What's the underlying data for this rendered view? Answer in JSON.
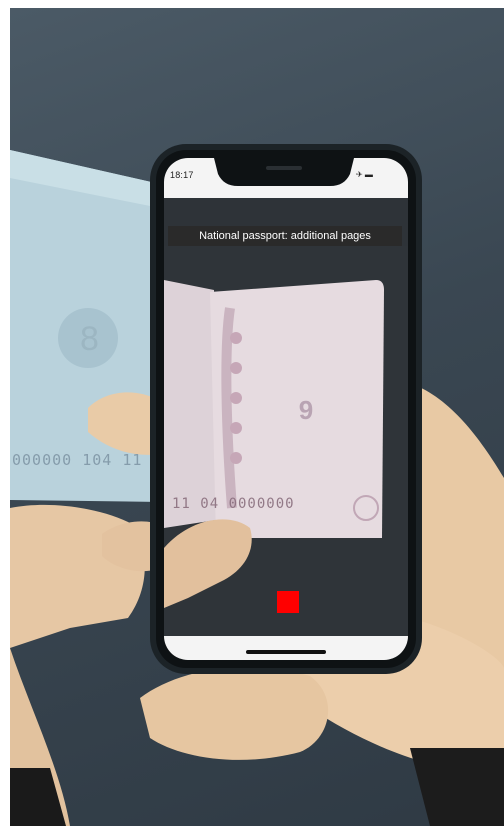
{
  "phone": {
    "status_time": "18:17",
    "status_icons": "✈ ▬",
    "screen_title": "National passport: additional pages"
  },
  "passport": {
    "page_number": "9",
    "mrz_left": "000000 104 11",
    "mrz_right": "11 04 0000000"
  },
  "colors": {
    "background": "#3a4752",
    "title_bar": "#2a2a2a",
    "capture_button": "#ff0000"
  },
  "icons": [
    "airplane-icon",
    "battery-icon",
    "capture-square-icon"
  ]
}
